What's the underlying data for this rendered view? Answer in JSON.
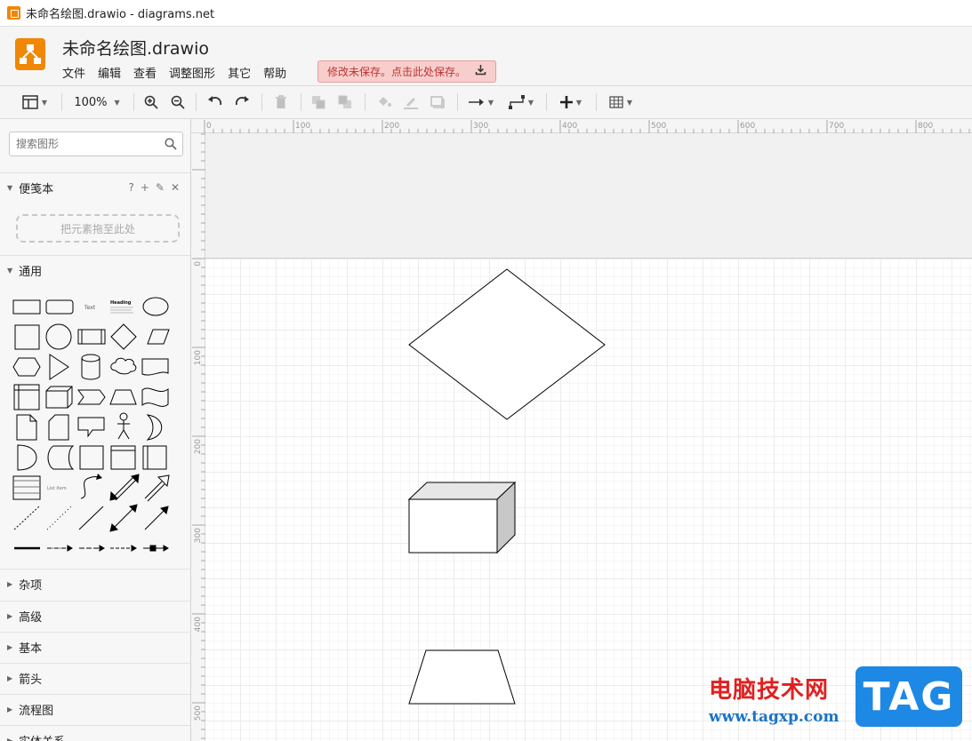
{
  "window": {
    "title": "未命名绘图.drawio - diagrams.net"
  },
  "header": {
    "doc_title": "未命名绘图.drawio",
    "menu": [
      "文件",
      "编辑",
      "查看",
      "调整图形",
      "其它",
      "帮助"
    ],
    "unsaved_notice": "修改未保存。点击此处保存。"
  },
  "toolbar": {
    "zoom": "100%",
    "buttons": [
      "format-panel-icon",
      "zoom-in-icon",
      "zoom-out-icon",
      "undo-icon",
      "redo-icon",
      "delete-icon",
      "to-front-icon",
      "to-back-icon",
      "fill-color-icon",
      "line-color-icon",
      "shadow-icon",
      "connection-icon",
      "waypoints-icon",
      "insert-icon",
      "table-icon"
    ]
  },
  "sidebar": {
    "search_placeholder": "搜索图形",
    "scratchpad": {
      "title": "便笺本",
      "help": "?",
      "drop_hint": "把元素拖至此处"
    },
    "general": {
      "title": "通用",
      "text_shape_label": "Text",
      "heading_shape_label": "Heading",
      "list_shape_label": "List Item"
    },
    "collapsed_sections": [
      "杂项",
      "高级",
      "基本",
      "箭头",
      "流程图",
      "实体关系"
    ]
  },
  "rulers": {
    "h_labels": [
      "0",
      "100",
      "200",
      "300",
      "400",
      "500",
      "600",
      "700",
      "800"
    ],
    "v_labels": [
      "0",
      "100",
      "200",
      "300",
      "400",
      "500"
    ]
  },
  "diagram": {
    "shapes": [
      "rhombus",
      "cube",
      "trapezoid"
    ],
    "colors": {
      "stroke": "#000000",
      "cube_side": "#c8c8c8",
      "cube_top": "#e6e6e6"
    }
  },
  "watermark": {
    "site_name": "电脑技术网",
    "url": "www.tagxp.com",
    "logo_text": "TAG"
  }
}
